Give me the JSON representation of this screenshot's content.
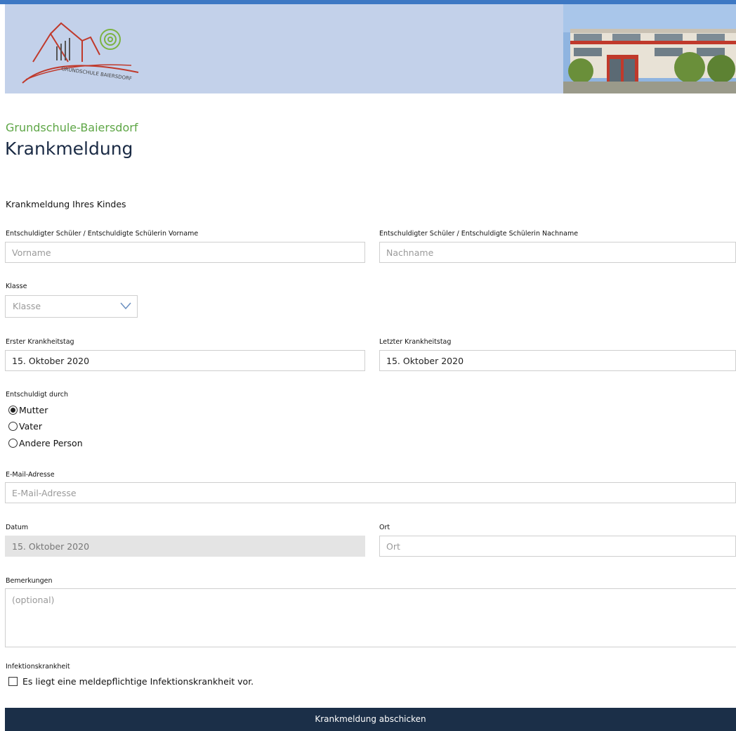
{
  "site": {
    "name": "Grundschule-Baiersdorf",
    "logo_text": "GRUNDSCHULE BAIERSDORF"
  },
  "page": {
    "title": "Krankmeldung",
    "section_heading": "Krankmeldung Ihres Kindes"
  },
  "form": {
    "vorname": {
      "label": "Entschuldigter Schüler / Entschuldigte Schülerin Vorname",
      "placeholder": "Vorname",
      "value": ""
    },
    "nachname": {
      "label": "Entschuldigter Schüler / Entschuldigte Schülerin Nachname",
      "placeholder": "Nachname",
      "value": ""
    },
    "klasse": {
      "label": "Klasse",
      "selected": "Klasse"
    },
    "erster_tag": {
      "label": "Erster Krankheitstag",
      "value": "15. Oktober 2020"
    },
    "letzter_tag": {
      "label": "Letzter Krankheitstag",
      "value": "15. Oktober 2020"
    },
    "entschuldigt": {
      "label": "Entschuldigt durch",
      "options": [
        {
          "label": "Mutter",
          "checked": true
        },
        {
          "label": "Vater",
          "checked": false
        },
        {
          "label": "Andere Person",
          "checked": false
        }
      ]
    },
    "email": {
      "label": "E-Mail-Adresse",
      "placeholder": "E-Mail-Adresse",
      "value": ""
    },
    "datum": {
      "label": "Datum",
      "value": "15. Oktober 2020"
    },
    "ort": {
      "label": "Ort",
      "placeholder": "Ort",
      "value": ""
    },
    "bemerkungen": {
      "label": "Bemerkungen",
      "placeholder": "(optional)"
    },
    "infektion": {
      "label": "Infektionskrankheit",
      "checkbox_label": "Es liegt eine meldepflichtige Infektionskrankheit vor.",
      "checked": false
    },
    "submit_label": "Krankmeldung abschicken"
  },
  "colors": {
    "accent_green": "#5ea646",
    "title_navy": "#1b2b45",
    "button_bg": "#1b2f48",
    "header_bg": "#c3d1ea",
    "top_bar": "#3d78c4"
  }
}
